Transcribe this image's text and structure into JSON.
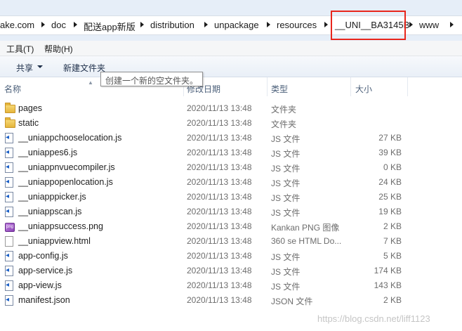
{
  "breadcrumb": [
    "ake.com",
    "doc",
    "配送app新版",
    "distribution",
    "unpackage",
    "resources",
    "__UNI__BA3145B",
    "www"
  ],
  "menu": [
    "工具(T)",
    "帮助(H)"
  ],
  "toolbar": {
    "share_label": "共享",
    "new_folder_label": "新建文件夹"
  },
  "tooltip": "创建一个新的空文件夹。",
  "columns": {
    "name": "名称",
    "date": "修改日期",
    "type": "类型",
    "size": "大小"
  },
  "files": [
    {
      "icon": "folder-icon",
      "name": "pages",
      "date": "2020/11/13 13:48",
      "type": "文件夹",
      "size": ""
    },
    {
      "icon": "folder-icon",
      "name": "static",
      "date": "2020/11/13 13:48",
      "type": "文件夹",
      "size": ""
    },
    {
      "icon": "js-file-icon",
      "name": "__uniappchooselocation.js",
      "date": "2020/11/13 13:48",
      "type": "JS 文件",
      "size": "27 KB"
    },
    {
      "icon": "js-file-icon",
      "name": "__uniappes6.js",
      "date": "2020/11/13 13:48",
      "type": "JS 文件",
      "size": "39 KB"
    },
    {
      "icon": "js-file-icon",
      "name": "__uniappnvuecompiler.js",
      "date": "2020/11/13 13:48",
      "type": "JS 文件",
      "size": "0 KB"
    },
    {
      "icon": "js-file-icon",
      "name": "__uniappopenlocation.js",
      "date": "2020/11/13 13:48",
      "type": "JS 文件",
      "size": "24 KB"
    },
    {
      "icon": "js-file-icon",
      "name": "__uniapppicker.js",
      "date": "2020/11/13 13:48",
      "type": "JS 文件",
      "size": "25 KB"
    },
    {
      "icon": "js-file-icon",
      "name": "__uniappscan.js",
      "date": "2020/11/13 13:48",
      "type": "JS 文件",
      "size": "19 KB"
    },
    {
      "icon": "png-file-icon",
      "name": "__uniappsuccess.png",
      "date": "2020/11/13 13:48",
      "type": "Kankan PNG 图像",
      "size": "2 KB"
    },
    {
      "icon": "html-file-icon",
      "name": "__uniappview.html",
      "date": "2020/11/13 13:48",
      "type": "360 se HTML Do...",
      "size": "7 KB"
    },
    {
      "icon": "js-file-icon",
      "name": "app-config.js",
      "date": "2020/11/13 13:48",
      "type": "JS 文件",
      "size": "5 KB"
    },
    {
      "icon": "js-file-icon",
      "name": "app-service.js",
      "date": "2020/11/13 13:48",
      "type": "JS 文件",
      "size": "174 KB"
    },
    {
      "icon": "js-file-icon",
      "name": "app-view.js",
      "date": "2020/11/13 13:48",
      "type": "JS 文件",
      "size": "143 KB"
    },
    {
      "icon": "json-file-icon",
      "name": "manifest.json",
      "date": "2020/11/13 13:48",
      "type": "JSON 文件",
      "size": "2 KB"
    }
  ],
  "watermark": "https://blog.csdn.net/liff1123",
  "colors": {
    "highlight": "#e8261c",
    "folder": "#e5b53b",
    "js_icon": "#1a5fc7"
  }
}
